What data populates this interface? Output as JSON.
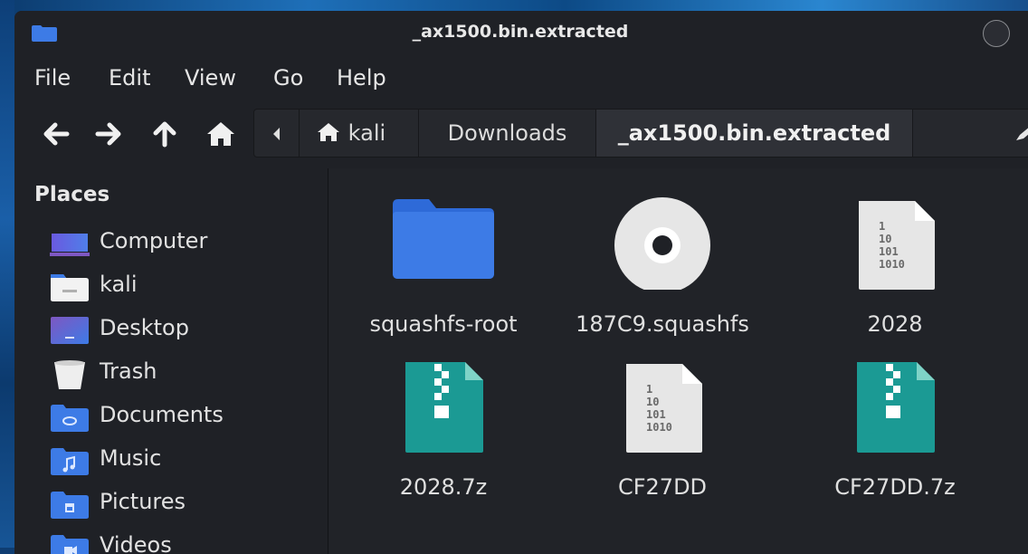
{
  "window": {
    "title": "_ax1500.bin.extracted"
  },
  "menu": {
    "items": [
      "File",
      "Edit",
      "View",
      "Go",
      "Help"
    ]
  },
  "toolbar": {
    "buttons": [
      "back-icon",
      "forward-icon",
      "up-icon",
      "home-icon"
    ]
  },
  "pathbar": {
    "segments": [
      {
        "label": "kali",
        "icon": "home-icon"
      },
      {
        "label": "Downloads"
      },
      {
        "label": "_ax1500.bin.extracted",
        "active": true
      }
    ]
  },
  "sidebar": {
    "header": "Places",
    "items": [
      {
        "label": "Computer",
        "icon": "computer-icon"
      },
      {
        "label": "kali",
        "icon": "home-folder-icon"
      },
      {
        "label": "Desktop",
        "icon": "desktop-icon"
      },
      {
        "label": "Trash",
        "icon": "trash-icon"
      },
      {
        "label": "Documents",
        "icon": "documents-folder-icon"
      },
      {
        "label": "Music",
        "icon": "music-folder-icon"
      },
      {
        "label": "Pictures",
        "icon": "pictures-folder-icon"
      },
      {
        "label": "Videos",
        "icon": "videos-folder-icon"
      }
    ]
  },
  "files": [
    {
      "name": "squashfs-root",
      "icon": "folder-icon"
    },
    {
      "name": "187C9.squashfs",
      "icon": "disc-image-icon"
    },
    {
      "name": "2028",
      "icon": "binary-file-icon"
    },
    {
      "name": "2028.7z",
      "icon": "archive-icon"
    },
    {
      "name": "CF27DD",
      "icon": "binary-file-icon"
    },
    {
      "name": "CF27DD.7z",
      "icon": "archive-icon"
    }
  ],
  "colors": {
    "window_bg": "#1f2126",
    "folder_blue": "#3d7be6",
    "archive_teal": "#1b9a94",
    "file_gray": "#e6e6e6"
  }
}
